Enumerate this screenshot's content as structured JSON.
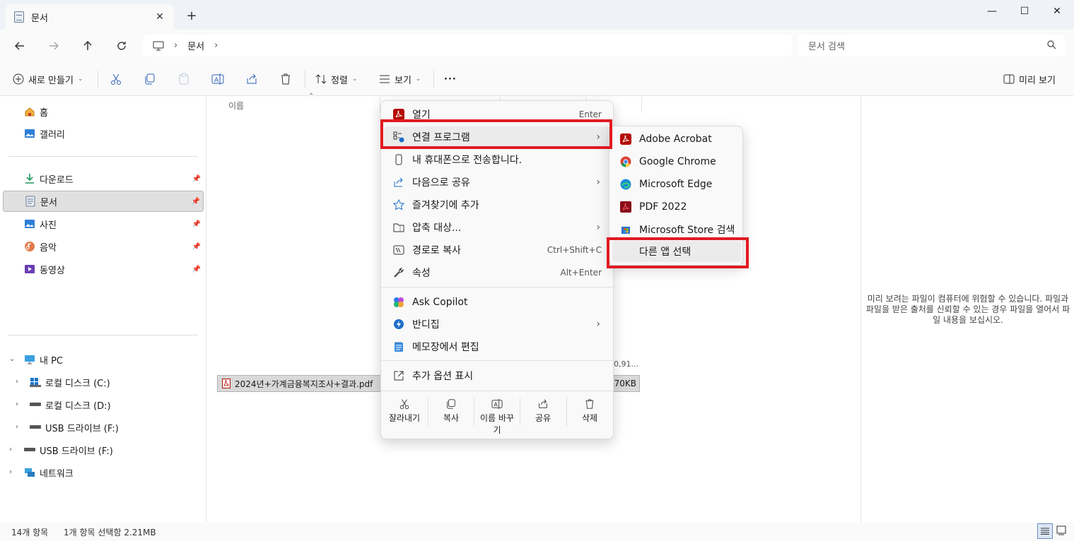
{
  "window": {
    "tab_title": "문서",
    "tab_close": "✕",
    "new_tab": "+",
    "minimize": "—",
    "maximize": "☐",
    "close": "✕"
  },
  "address": {
    "crumb": "문서",
    "search_placeholder": "문서 검색"
  },
  "toolbar": {
    "new_label": "새로 만들기",
    "sort_label": "정렬",
    "view_label": "보기",
    "more_label": "···",
    "preview_label": "미리 보기"
  },
  "sidebar": {
    "home": "홈",
    "gallery": "갤러리",
    "downloads": "다운로드",
    "documents": "문서",
    "pictures": "사진",
    "music": "음악",
    "videos": "동영상",
    "this_pc": "내 PC",
    "drive_c": "로컬 디스크 (C:)",
    "drive_d": "로컬 디스크 (D:)",
    "usb_f_1": "USB 드라이브 (F:)",
    "usb_f_2": "USB 드라이브 (F:)",
    "network": "네트워크"
  },
  "content": {
    "col_name": "이름",
    "file_name": "2024년+가계금융복지조사+결과.pdf",
    "partial_date": "0,91...",
    "file_size": "270KB"
  },
  "preview_pane": {
    "message": "미리 보려는 파일이 컴퓨터에 위험할 수 있습니다. 파일과 파일을 받은 출처를 신뢰할 수 있는 경우 파일을 열어서 파일 내용을 보십시오."
  },
  "status": {
    "count": "14개 항목",
    "selected": "1개 항목 선택함 2.21MB"
  },
  "context_menu": {
    "open": "열기",
    "open_shortcut": "Enter",
    "open_with": "연결 프로그램",
    "send_to_phone": "내 휴대폰으로 전송합니다.",
    "share_with": "다음으로 공유",
    "add_favorites": "즐겨찾기에 추가",
    "compress": "압축 대상...",
    "copy_path": "경로로 복사",
    "copy_path_shortcut": "Ctrl+Shift+C",
    "properties": "속성",
    "properties_shortcut": "Alt+Enter",
    "ask_copilot": "Ask Copilot",
    "bandizip": "반디집",
    "notepad": "메모장에서 편집",
    "more_options": "추가 옵션 표시",
    "qa_cut": "잘라내기",
    "qa_copy": "복사",
    "qa_rename_1": "이름 바꾸",
    "qa_rename_2": "기",
    "qa_share": "공유",
    "qa_delete": "삭제"
  },
  "submenu": {
    "acrobat": "Adobe Acrobat",
    "chrome": "Google Chrome",
    "edge": "Microsoft Edge",
    "pdf2022": "PDF 2022",
    "store": "Microsoft Store 검색",
    "choose_other": "다른 앱 선택"
  },
  "colors": {
    "highlight_red": "#e11b22",
    "acrobat_red": "#b30b00"
  }
}
